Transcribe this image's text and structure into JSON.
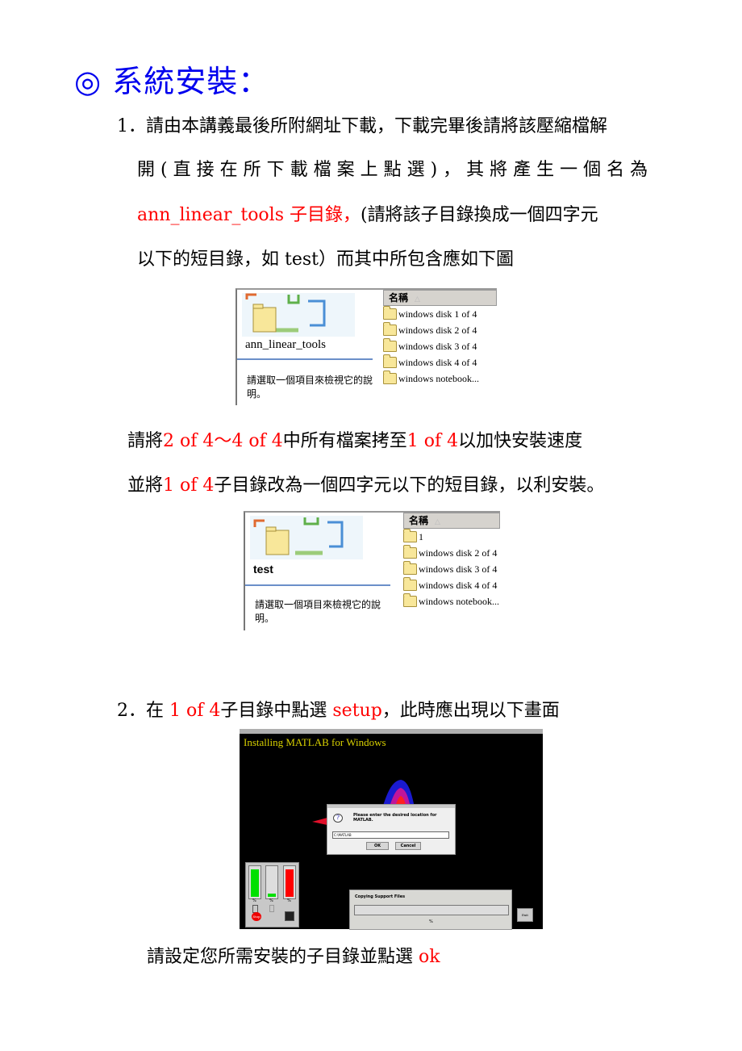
{
  "heading": "◎ 系統安裝：",
  "step1": {
    "line1": "1．請由本講義最後所附網址下載，下載完畢後請將該壓縮檔解",
    "line2": "開(直接在所下載檔案上點選)，其將產生一個名為",
    "line3_red": "ann_linear_tools 子目錄，",
    "line3_black": "(請將該子目錄換成一個四字元",
    "line4": "以下的短目錄，如 test）而其中所包含應如下圖"
  },
  "explorer1": {
    "folder_title": "ann_linear_tools",
    "description_line1": "請選取一個項目來檢視它的說",
    "description_line2": "明。",
    "column_header": "名稱",
    "sort_glyph": "△",
    "items": [
      "windows disk 1 of 4",
      "windows disk 2 of 4",
      "windows disk 3 of 4",
      "windows disk 4 of 4",
      "windows notebook..."
    ]
  },
  "copy_instruction": {
    "a1": "請將",
    "a2_red": "2 of 4～4 of 4",
    "a3": "中所有檔案拷至",
    "a4_red": "1 of 4",
    "a5": "以加快安裝速度",
    "b1": "並將",
    "b2_red": "1 of 4",
    "b3": "子目錄改為一個四字元以下的短目錄，以利安裝。"
  },
  "explorer2": {
    "folder_title": "test",
    "description_line1": "請選取一個項目來檢視它的說",
    "description_line2": "明。",
    "column_header": "名稱",
    "sort_glyph": "△",
    "items": [
      "1",
      "windows disk 2 of 4",
      "windows disk 3 of 4",
      "windows disk 4 of 4",
      "windows notebook..."
    ]
  },
  "step2": {
    "a1": "2．在",
    "a2_red": "1 of 4",
    "a3": "子目錄中點選",
    "a4_red": "setup",
    "a5": "，此時應出現以下畫面"
  },
  "installer": {
    "title": "Installing MATLAB for Windows",
    "dialog_message": "Please enter the desired location for MATLAB.",
    "dialog_input_value": "C:\\MATLAB",
    "ok_label": "OK",
    "cancel_label": "Cancel",
    "gauge_labels": [
      "%",
      "%",
      "%"
    ],
    "gauge_levels": [
      0.95,
      0.1,
      0.95
    ],
    "gauge_colors": [
      "#00e000",
      "#00e000",
      "#ff0000"
    ],
    "stop_label": "Stop",
    "progress_label": "Copying Support Files",
    "progress_percent_label": "%",
    "progress_value": 0,
    "exit_label": "Exit"
  },
  "final_instruction": {
    "text": "請設定您所需安裝的子目錄並點選",
    "red": "ok"
  }
}
